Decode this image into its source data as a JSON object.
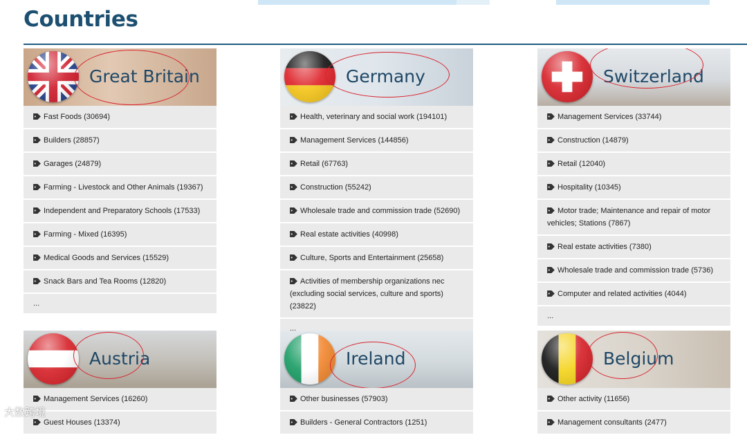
{
  "page": {
    "title": "Countries"
  },
  "countries": [
    {
      "id": "great-britain",
      "name": "Great Britain",
      "banner_color": "#d8b79a",
      "items": [
        "Fast Foods (30694)",
        "Builders (28857)",
        "Garages (24879)",
        "Farming - Livestock and Other Animals (19367)",
        "Independent and Preparatory Schools (17533)",
        "Farming - Mixed (16395)",
        "Medical Goods and Services (15529)",
        "Snack Bars and Tea Rooms (12820)"
      ],
      "more": "..."
    },
    {
      "id": "germany",
      "name": "Germany",
      "banner_color": "#e3e9ee",
      "items": [
        "Health, veterinary and social work (194101)",
        "Management Services (144856)",
        "Retail (67763)",
        "Construction (55242)",
        "Wholesale trade and commission trade (52690)",
        "Real estate activities (40998)",
        "Culture, Sports and Entertainment (25658)",
        "Activities of membership organizations nec (excluding social services, culture and sports) (23822)"
      ],
      "more": "..."
    },
    {
      "id": "switzerland",
      "name": "Switzerland",
      "banner_color": "#d9dde2",
      "items": [
        "Management Services (33744)",
        "Construction (14879)",
        "Retail (12040)",
        "Hospitality (10345)",
        "Motor trade; Maintenance and repair of motor vehicles; Stations (7867)",
        "Real estate activities (7380)",
        "Wholesale trade and commission trade (5736)",
        "Computer and related activities (4044)"
      ],
      "more": "..."
    },
    {
      "id": "austria",
      "name": "Austria",
      "banner_color": "#c9c7c2",
      "items": [
        "Management Services (16260)",
        "Guest Houses (13374)"
      ]
    },
    {
      "id": "ireland",
      "name": "Ireland",
      "banner_color": "#d7dfe4",
      "items": [
        "Other businesses (57903)",
        "Builders - General Contractors (1251)"
      ]
    },
    {
      "id": "belgium",
      "name": "Belgium",
      "banner_color": "#dcd8d2",
      "items": [
        "Other activity (11656)",
        "Management consultants (2477)"
      ]
    }
  ],
  "watermark": "大数跨境",
  "colors": {
    "accent": "#1f5b82",
    "title": "#1c4f70",
    "annotation": "#d9232d",
    "row": "#eaeaea"
  }
}
